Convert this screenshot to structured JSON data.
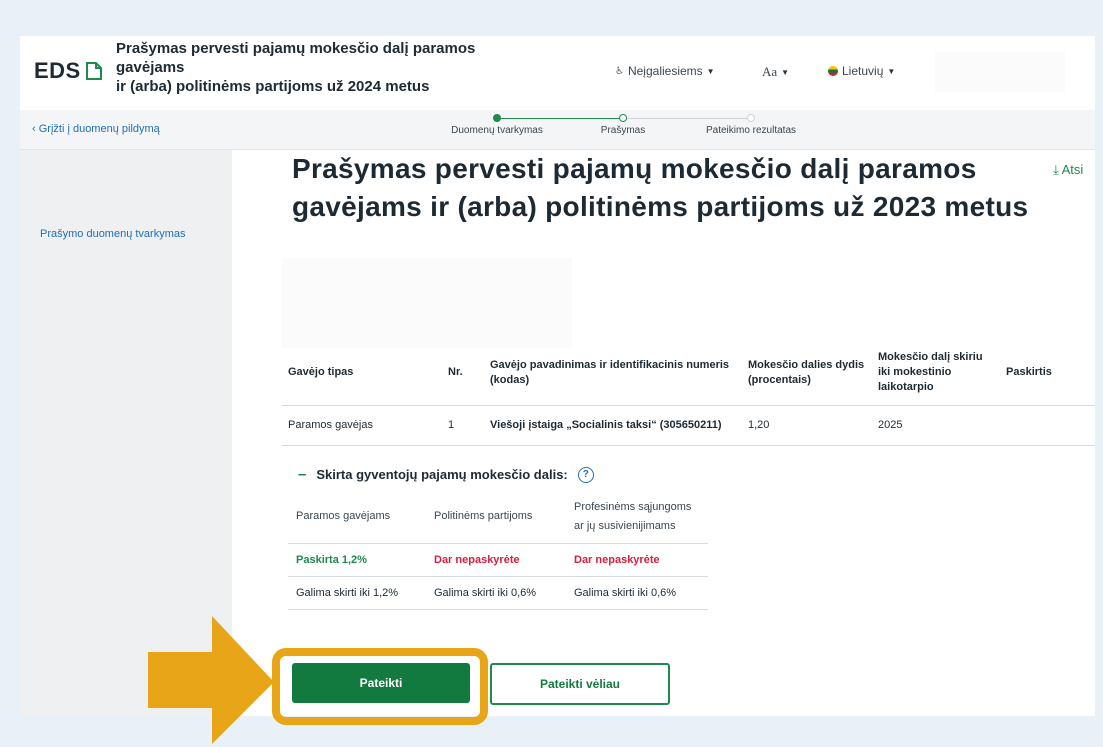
{
  "header": {
    "logo": "EDS",
    "title_lines": [
      "Prašymas pervesti pajamų mokesčio dalį paramos",
      "gavėjams",
      "ir (arba) politinėms partijoms už 2024 metus"
    ],
    "accessibility": "Neįgaliesiems",
    "font_size": "Aa",
    "language": "Lietuvių"
  },
  "nav": {
    "back": "Grįžti į duomenų pildymą",
    "steps": [
      "Duomenų tvarkymas",
      "Prašymas",
      "Pateikimo rezultatas"
    ]
  },
  "sidebar": {
    "items": [
      "Prašymo duomenų tvarkymas"
    ]
  },
  "main": {
    "title": "Prašymas pervesti pajamų mokesčio dalį paramos gavėjams ir (arba) politinėms partijoms už 2023 metus",
    "download": "Atsi",
    "table": {
      "headers": [
        "Gavėjo tipas",
        "Nr.",
        "Gavėjo pavadinimas ir identifikacinis numeris (kodas)",
        "Mokesčio dalies dydis (procentais)",
        "Mokesčio dalį skiriu iki mokestinio laikotarpio",
        "Paskirtis"
      ],
      "rows": [
        [
          "Paramos gavėjas",
          "1",
          "Viešoji įstaiga „Socialinis taksi“ (305650211)",
          "1,20",
          "2025",
          ""
        ]
      ]
    },
    "allocation": {
      "title": "Skirta gyventojų pajamų mokesčio dalis:",
      "help": "?",
      "headers": [
        "Paramos gavėjams",
        "Politinėms partijoms",
        "Profesinėms sąjungoms ar jų susivienijimams"
      ],
      "status": [
        "Paskirta 1,2%",
        "Dar nepaskyrėte",
        "Dar nepaskyrėte"
      ],
      "limits": [
        "Galima skirti iki 1,2%",
        "Galima skirti iki 0,6%",
        "Galima skirti iki 0,6%"
      ]
    },
    "buttons": {
      "submit": "Pateikti",
      "later": "Pateikti vėliau"
    }
  },
  "colors": {
    "brand_green": "#137a3f",
    "link_blue": "#1f6fb5",
    "alert_red": "#d4213d",
    "highlight_orange": "#e8a517"
  }
}
